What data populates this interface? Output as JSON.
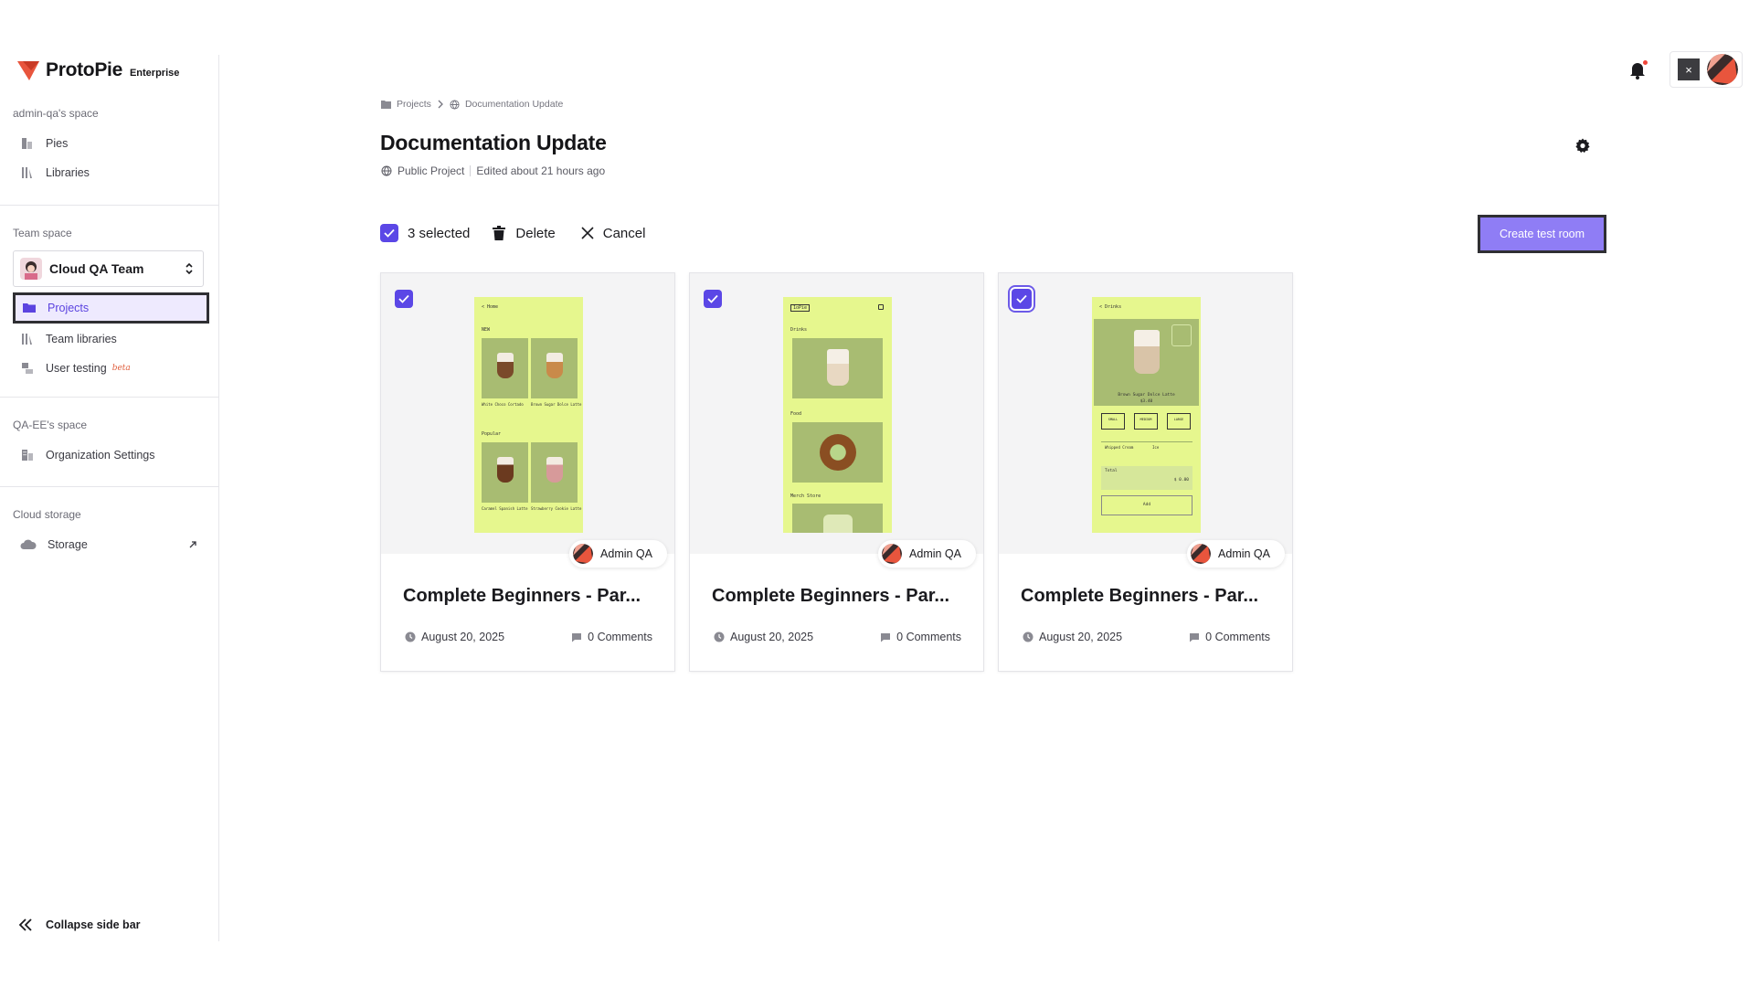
{
  "brand": {
    "name": "ProtoPie",
    "edition": "Enterprise",
    "color": "#e8553d"
  },
  "sidebar": {
    "personal_label": "admin-qa's space",
    "personal_items": [
      {
        "label": "Pies",
        "icon": "pies-icon"
      },
      {
        "label": "Libraries",
        "icon": "libraries-icon"
      }
    ],
    "team_label": "Team space",
    "team_selector": "Cloud QA Team",
    "team_items": [
      {
        "label": "Projects",
        "icon": "folder-icon",
        "active": true
      },
      {
        "label": "Team libraries",
        "icon": "libraries-icon"
      },
      {
        "label": "User testing",
        "icon": "user-testing-icon",
        "badge": "beta"
      }
    ],
    "org_label": "QA-EE's space",
    "org_items": [
      {
        "label": "Organization Settings",
        "icon": "building-icon"
      }
    ],
    "storage_label": "Cloud storage",
    "storage_items": [
      {
        "label": "Storage",
        "icon": "cloud-icon"
      }
    ],
    "collapse_label": "Collapse side bar"
  },
  "topbar": {
    "close_label": "×",
    "has_notification": true
  },
  "breadcrumb": {
    "root": "Projects",
    "current": "Documentation Update"
  },
  "project": {
    "title": "Documentation Update",
    "visibility": "Public Project",
    "edited": "Edited about 21 hours ago"
  },
  "toolbar": {
    "selected": "3 selected",
    "delete_label": "Delete",
    "cancel_label": "Cancel",
    "create_label": "Create test room"
  },
  "colors": {
    "accent": "#5b47e6",
    "button": "#8f7df5",
    "screen_bg": "#e6f78e"
  },
  "cards": [
    {
      "title": "Complete Beginners - Par...",
      "owner": "Admin QA",
      "date": "August 20, 2025",
      "comments": "0 Comments",
      "checked": true,
      "screen": {
        "header": "< Home",
        "s1": "NEW",
        "s2": "Popular",
        "captions": [
          "White Choco Cortado",
          "Brown Sugar Dolce Latte",
          "Caramel Spanish Latte",
          "Strawberry Cookie Latte"
        ]
      }
    },
    {
      "title": "Complete Beginners - Par...",
      "owner": "Admin QA",
      "date": "August 20, 2025",
      "comments": "0 Comments",
      "checked": true,
      "screen": {
        "header": "1oPie",
        "s1": "Drinks",
        "s2": "Food",
        "s3": "Merch Store"
      }
    },
    {
      "title": "Complete Beginners - Par...",
      "owner": "Admin QA",
      "date": "August 20, 2025",
      "comments": "0 Comments",
      "checked": true,
      "screen": {
        "header": "< Drinks",
        "product": "Brown Sugar Dolce Latte",
        "price": "$3.40",
        "sizes": [
          "SMALL",
          "MEDIUM",
          "LARGE"
        ],
        "opt1": "Whipped Cream",
        "opt2": "Ice",
        "total_label": "Total",
        "total": "$ 0.00",
        "add": "Add"
      }
    }
  ]
}
